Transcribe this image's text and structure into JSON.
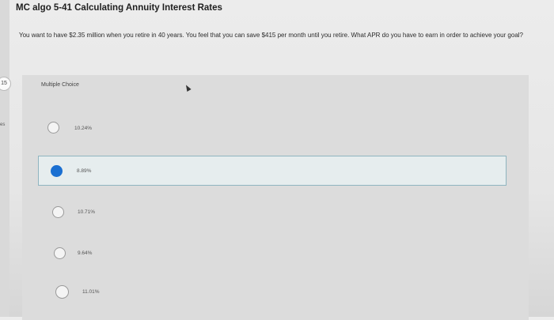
{
  "title": "MC algo 5-41 Calculating Annuity Interest Rates",
  "question": "You want to have $2.35 million when you retire in 40 years. You feel that you can save $415 per month until you retire. What APR do you have to earn in order to achieve your goal?",
  "sidebar": {
    "badge": "15",
    "label": "es"
  },
  "multiple_choice_label": "Multiple Choice",
  "options": [
    {
      "label": "10.24%",
      "selected": false
    },
    {
      "label": "8.89%",
      "selected": true
    },
    {
      "label": "10.71%",
      "selected": false
    },
    {
      "label": "9.64%",
      "selected": false
    },
    {
      "label": "11.01%",
      "selected": false
    }
  ],
  "colors": {
    "selected_radio": "#1a6fd1",
    "selected_border": "#8fb5c0"
  }
}
